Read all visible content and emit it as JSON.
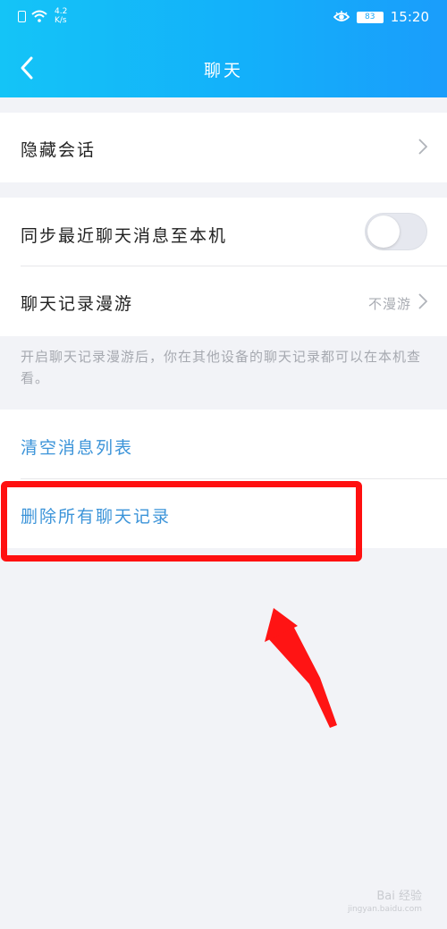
{
  "status_bar": {
    "network_speed_value": "4.2",
    "network_speed_unit": "K/s",
    "battery": "83",
    "time": "15:20",
    "icons": [
      "sim-icon",
      "wifi-icon",
      "eye-comfort-icon",
      "battery-icon"
    ]
  },
  "header": {
    "title": "聊天",
    "back_icon": "back-chevron-icon"
  },
  "settings": {
    "hidden_chats_label": "隐藏会话",
    "sync_label": "同步最近聊天消息至本机",
    "sync_enabled": false,
    "roaming_label": "聊天记录漫游",
    "roaming_value": "不漫游",
    "roaming_hint": "开启聊天记录漫游后，你在其他设备的聊天记录都可以在本机查看。"
  },
  "actions": {
    "clear_list_label": "清空消息列表",
    "delete_all_label": "删除所有聊天记录"
  },
  "annotation": {
    "highlight_color": "#ff1010",
    "arrow_color": "#ff1010"
  },
  "watermark": {
    "text": "Bai 经验",
    "subtext": "jingyan.baidu.com"
  },
  "colors": {
    "header_gradient_start": "#14c4f7",
    "header_gradient_end": "#1a9dfb",
    "action_text": "#3c94d9",
    "background": "#f2f3f7"
  }
}
